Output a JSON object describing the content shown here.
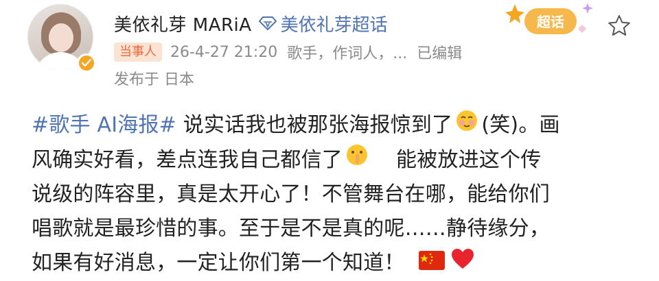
{
  "user": {
    "name": "美依礼芽 MARiA",
    "supertopic": "美依礼芽超话",
    "tag": "当事人",
    "timestamp": "26-4-27 21:20",
    "roles": "歌手，作词人，...",
    "edited": "已编辑",
    "location": "发布于 日本"
  },
  "badge": {
    "label": "超话"
  },
  "post": {
    "hashtag": "#歌手 AI海报#",
    "line1_text": " 说实话我也被那张海报惊到了",
    "line1_tail": "(笑)。画",
    "line2_text": "风确实好看，差点连我自己都信了",
    "line2_tail": "能被放进这个传",
    "line3": "说级的阵容里，真是太开心了！不管舞台在哪，能给你们",
    "line4": "唱歌就是最珍惜的事。至于是不是真的呢……静待缘分，",
    "line5_text": "如果有好消息，一定让你们第一个知道！"
  },
  "colors": {
    "link": "#4f74b3",
    "tag_bg": "#fbe3d4",
    "tag_text": "#e8693a",
    "verified": "#f6a623"
  },
  "icons": [
    "verified-badge-icon",
    "supertopic-diamond-icon",
    "star-icon",
    "flushed-face-emoji",
    "shushing-face-emoji",
    "china-flag-emoji",
    "red-heart-emoji"
  ]
}
